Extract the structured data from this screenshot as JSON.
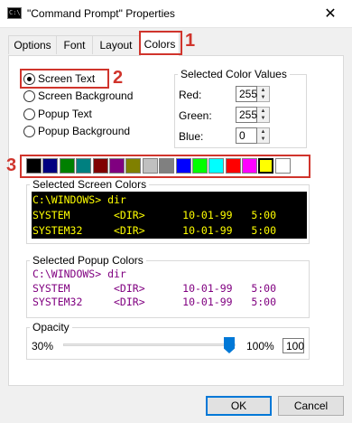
{
  "window": {
    "title": "\"Command Prompt\" Properties",
    "close_glyph": "✕",
    "icon": "console-icon",
    "icon_text": "C:\\."
  },
  "tabs": [
    {
      "label": "Options"
    },
    {
      "label": "Font"
    },
    {
      "label": "Layout"
    },
    {
      "label": "Colors"
    }
  ],
  "callouts": [
    "1",
    "2",
    "3"
  ],
  "radio_options": [
    {
      "label": "Screen Text",
      "checked": true
    },
    {
      "label": "Screen Background",
      "checked": false
    },
    {
      "label": "Popup Text",
      "checked": false
    },
    {
      "label": "Popup Background",
      "checked": false
    }
  ],
  "color_values": {
    "title": "Selected Color Values",
    "red_label": "Red:",
    "red": "255",
    "green_label": "Green:",
    "green": "255",
    "blue_label": "Blue:",
    "blue": "0"
  },
  "palette": [
    "#000000",
    "#000080",
    "#008000",
    "#008080",
    "#800000",
    "#800080",
    "#808000",
    "#c0c0c0",
    "#808080",
    "#0000ff",
    "#00ff00",
    "#00ffff",
    "#ff0000",
    "#ff00ff",
    "#ffff00",
    "#ffffff"
  ],
  "palette_selected_index": 14,
  "screen_colors": {
    "title": "Selected Screen Colors",
    "lines": [
      "C:\\WINDOWS> dir",
      "SYSTEM       <DIR>      10-01-99   5:00",
      "SYSTEM32     <DIR>      10-01-99   5:00"
    ],
    "text_color": "#ffff00",
    "background": "#000000"
  },
  "popup_colors": {
    "title": "Selected Popup Colors",
    "lines": [
      "C:\\WINDOWS> dir",
      "SYSTEM       <DIR>      10-01-99   5:00",
      "SYSTEM32     <DIR>      10-01-99   5:00"
    ],
    "text_color": "#800080",
    "background": "#ffffff"
  },
  "opacity": {
    "title": "Opacity",
    "min_label": "30%",
    "max_label": "100%",
    "value": "100"
  },
  "buttons": {
    "ok": "OK",
    "cancel": "Cancel"
  }
}
